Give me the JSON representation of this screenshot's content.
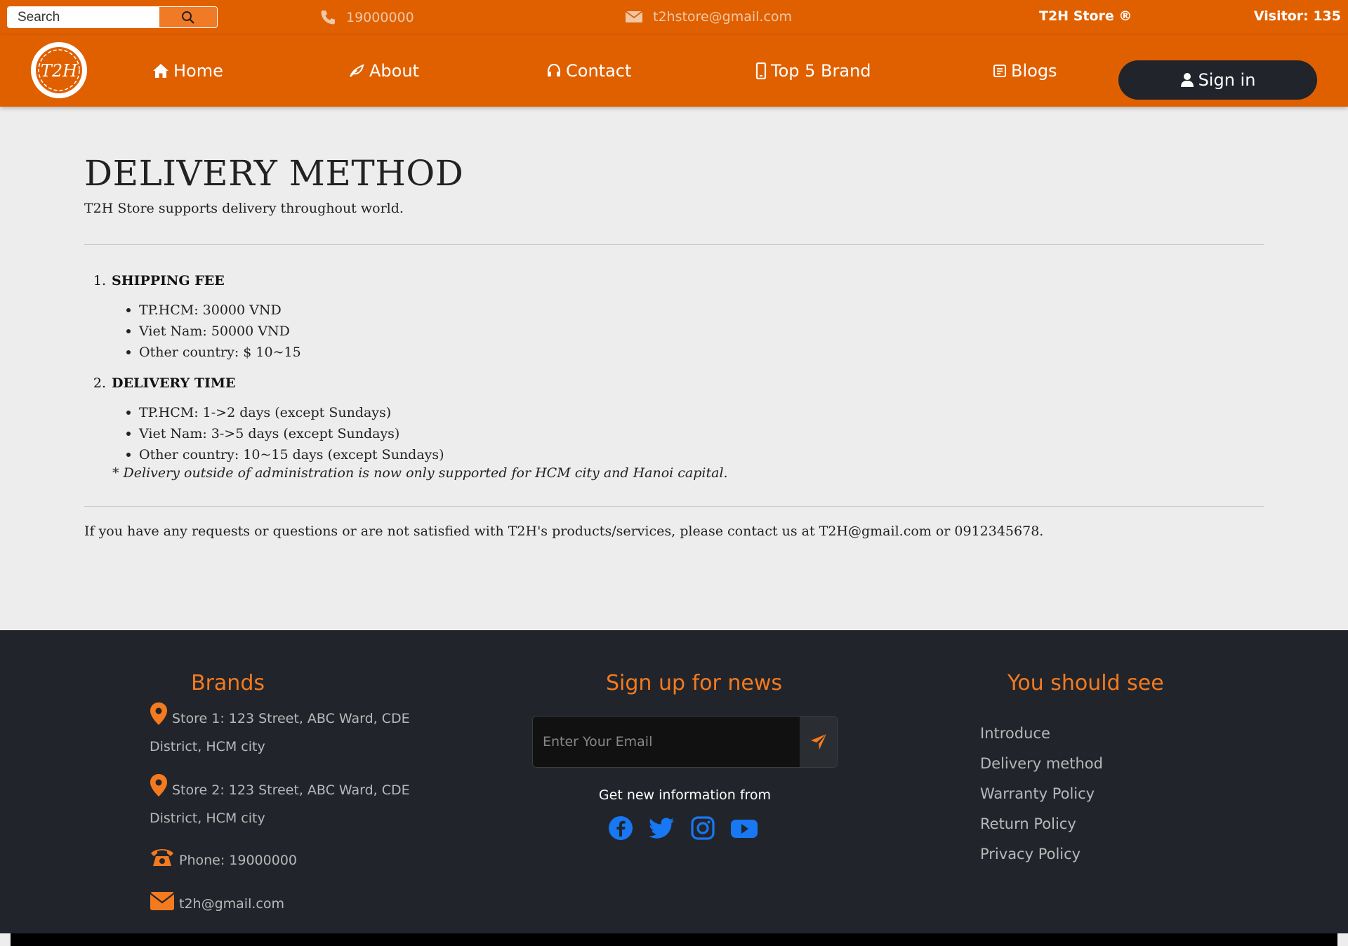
{
  "topbar": {
    "search_placeholder": "Search",
    "phone": "19000000",
    "email": "t2hstore@gmail.com",
    "brand": "T2H Store ®",
    "visitor": "Visitor: 135"
  },
  "nav": {
    "logo_text": "T2H",
    "items": [
      {
        "label": "Home",
        "icon": "home-icon"
      },
      {
        "label": "About",
        "icon": "leaf-icon"
      },
      {
        "label": "Contact",
        "icon": "headset-icon"
      },
      {
        "label": "Top 5 Brand",
        "icon": "phone-icon"
      },
      {
        "label": "Blogs",
        "icon": "blog-icon"
      }
    ],
    "signin": "Sign in"
  },
  "main": {
    "title": "DELIVERY METHOD",
    "subtitle": "T2H Store supports delivery throughout world.",
    "sections": [
      {
        "num": "1.",
        "title": "SHIPPING FEE",
        "items": [
          "TP.HCM: 30000 VND",
          "Viet Nam: 50000 VND",
          "Other country: $ 10~15"
        ]
      },
      {
        "num": "2.",
        "title": "DELIVERY TIME",
        "items": [
          "TP.HCM: 1->2 days (except Sundays)",
          "Viet Nam: 3->5 days (except Sundays)",
          "Other country: 10~15 days (except Sundays)"
        ]
      }
    ],
    "note": "* Delivery outside of administration is now only supported for HCM city and Hanoi capital.",
    "contact": "If you have any requests or questions or are not satisfied with T2H's products/services, please contact us at T2H@gmail.com or 0912345678."
  },
  "footer": {
    "brands_heading": "Brands",
    "store1": "Store 1: 123 Street, ABC Ward, CDE District, HCM city",
    "store2": "Store 2: 123 Street, ABC Ward, CDE District, HCM city",
    "phone": "Phone: 19000000",
    "email": "t2h@gmail.com",
    "news_heading": "Sign up for news",
    "email_placeholder": "Enter Your Email",
    "getinfo": "Get new information from",
    "socials": [
      "facebook-icon",
      "twitter-icon",
      "instagram-icon",
      "youtube-icon"
    ],
    "see_heading": "You should see",
    "links": [
      "Introduce",
      "Delivery method",
      "Warranty Policy",
      "Return Policy",
      "Privacy Policy"
    ]
  },
  "colors": {
    "brand_orange": "#e06000",
    "accent_orange": "#f47a1f",
    "footer_bg": "#21252b",
    "social_blue": "#1877f2"
  }
}
